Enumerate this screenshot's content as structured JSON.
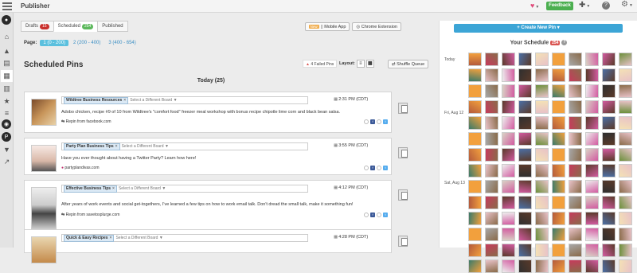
{
  "app": {
    "title": "Publisher"
  },
  "header": {
    "feedback_label": "Feedback"
  },
  "tabs": [
    {
      "label": "Drafts",
      "count": "15"
    },
    {
      "label": "Scheduled",
      "count": "254"
    },
    {
      "label": "Published",
      "count": ""
    }
  ],
  "top_buttons": {
    "new_tag": "New",
    "mobile": "Mobile App",
    "chrome": "Chrome Extension"
  },
  "pager": {
    "label": "Page:",
    "pages": [
      "1 (0 - 200)",
      "2 (200 - 400)",
      "3 (400 - 654)"
    ]
  },
  "section": {
    "title": "Scheduled Pins",
    "failed_label": "4 Failed Pins",
    "layout_label": "Layout:",
    "shuffle_label": "Shuffle Queue",
    "day_heading": "Today (25)"
  },
  "board_placeholder": "Select a Different Board",
  "pins": [
    {
      "board": "Wildtree Business Resources",
      "time": "2:31 PM (CDT)",
      "caption": "Adobo chicken, recipe #9 of 10 from Wildtree's \"comfort food\" freezer meal workshop with bonus recipe chipotle lime corn and black bean salsa.",
      "source": "Repin from facebook.com"
    },
    {
      "board": "Party Plan Business Tips",
      "time": "3:55 PM (CDT)",
      "caption": "Have you ever thought about having a Twitter Party? Learn how here!",
      "source": "partyplandivas.com"
    },
    {
      "board": "Effective Business Tips",
      "time": "4:12 PM (CDT)",
      "caption": "After years of work events and social get-togethers, I've learned a few tips on how to work email talk. Don't dread the small talk, make it something fun!",
      "source": "Repin from savetosplurge.com"
    },
    {
      "board": "Quick & Easy Recipes",
      "time": "4:28 PM (CDT)",
      "caption": "",
      "source": ""
    }
  ],
  "schedule": {
    "create_label": "+ Create New Pin",
    "title": "Your Schedule",
    "count": "254",
    "days": [
      "Today",
      "Fri, Aug 12",
      "Sat, Aug 13"
    ]
  },
  "colors": {
    "accent": "#3ca5d6",
    "feedback": "#4caf50",
    "danger": "#d9534f",
    "tag": "#dbe9f5"
  }
}
